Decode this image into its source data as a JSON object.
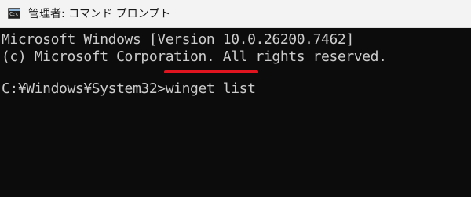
{
  "window": {
    "title": "管理者: コマンド プロンプト",
    "icon": "cmd-icon",
    "icon_text": "C:\\"
  },
  "console": {
    "line1": "Microsoft Windows [Version 10.0.26200.7462]",
    "line2": "(c) Microsoft Corporation. All rights reserved.",
    "prompt": "C:¥Windows¥System32>",
    "command": "winget list"
  },
  "colors": {
    "console_bg": "#0c0c0c",
    "console_text": "#cccccc",
    "titlebar_bg": "#f3f3f3",
    "highlight_underline": "#e0141e"
  }
}
